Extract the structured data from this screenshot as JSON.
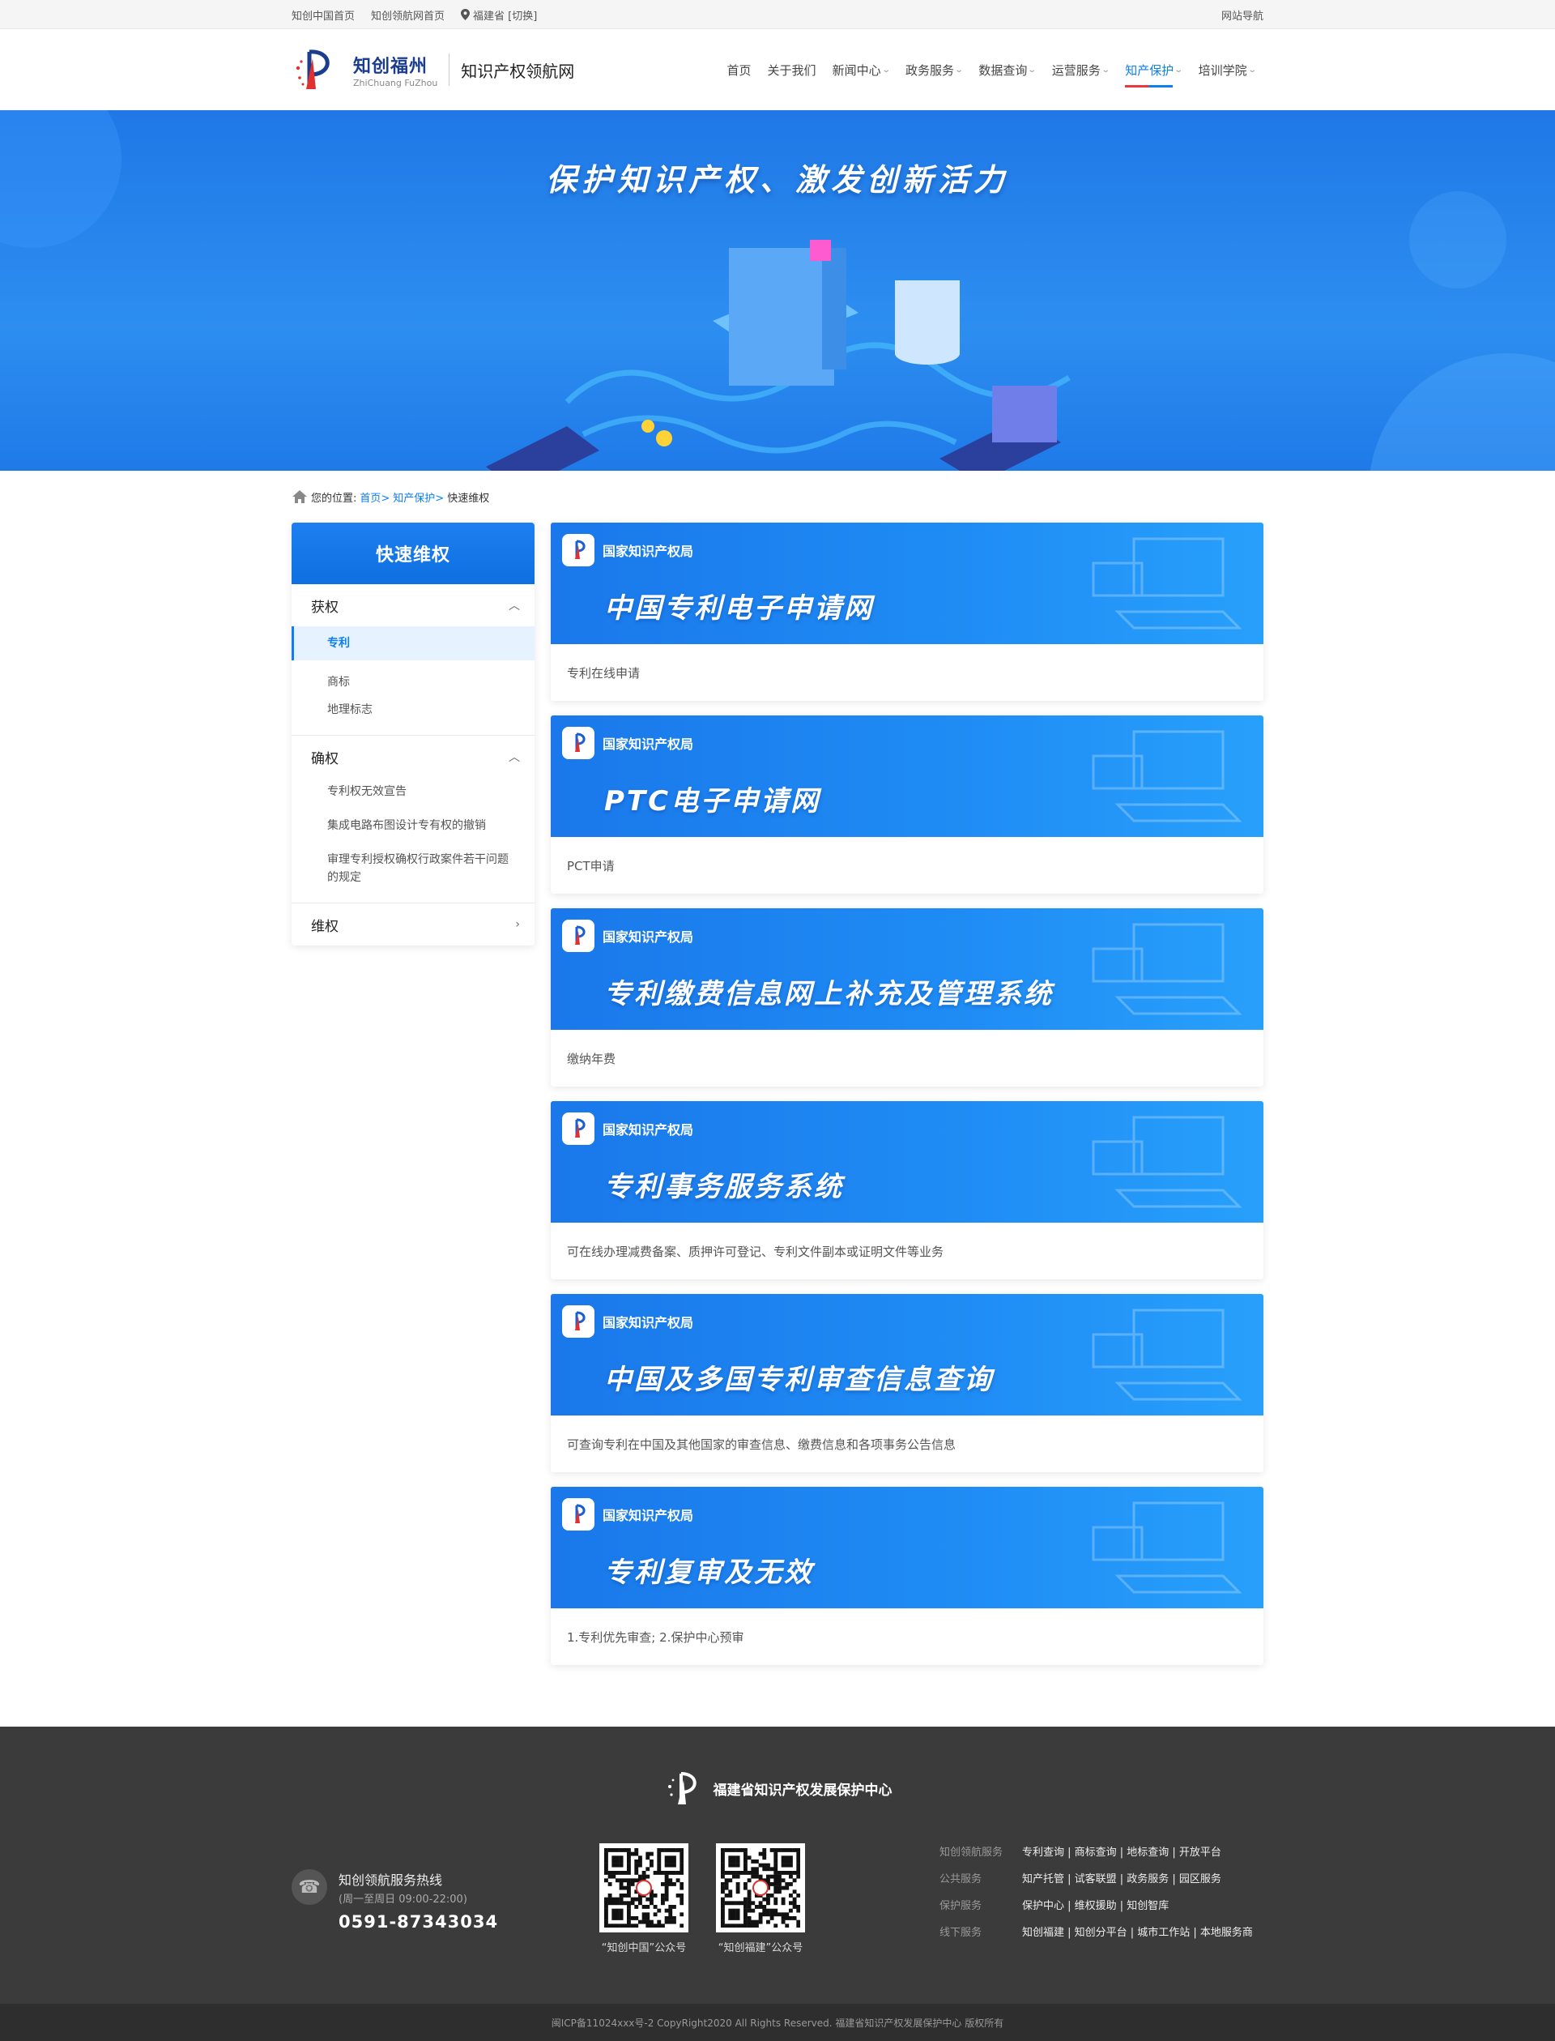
{
  "topbar": {
    "links": [
      "知创中国首页",
      "知创领航网首页"
    ],
    "location": "福建省 [切换]",
    "site_nav": "网站导航"
  },
  "header": {
    "brand_cn": "知创福州",
    "brand_en": "ZhiChuang FuZhou",
    "brand_sub": "知识产权领航网",
    "nav": [
      {
        "label": "首页",
        "dropdown": false
      },
      {
        "label": "关于我们",
        "dropdown": false
      },
      {
        "label": "新闻中心",
        "dropdown": true
      },
      {
        "label": "政务服务",
        "dropdown": true
      },
      {
        "label": "数据查询",
        "dropdown": true
      },
      {
        "label": "运营服务",
        "dropdown": true
      },
      {
        "label": "知产保护",
        "dropdown": true,
        "active": true
      },
      {
        "label": "培训学院",
        "dropdown": true
      }
    ]
  },
  "banner": {
    "title": "保护知识产权、激发创新活力"
  },
  "breadcrumb": {
    "prefix": "您的位置:",
    "home": "首页>",
    "section": "知产保护>",
    "current": "快速维权"
  },
  "sidebar": {
    "title": "快速维权",
    "groups": [
      {
        "label": "获权",
        "expanded": true,
        "items": [
          "专利",
          "商标",
          "地理标志"
        ],
        "active_item": 0
      },
      {
        "label": "确权",
        "expanded": true,
        "items": [
          "专利权无效宣告",
          "集成电路布图设计专有权的撤销",
          "审理专利授权确权行政案件若干问题的规定"
        ]
      },
      {
        "label": "维权",
        "expanded": false,
        "items": []
      }
    ]
  },
  "cards": [
    {
      "org": "国家知识产权局",
      "title": "中国专利电子申请网",
      "desc": "专利在线申请"
    },
    {
      "org": "国家知识产权局",
      "title": "PTC电子申请网",
      "desc": "PCT申请"
    },
    {
      "org": "国家知识产权局",
      "title": "专利缴费信息网上补充及管理系统",
      "desc": "缴纳年费"
    },
    {
      "org": "国家知识产权局",
      "title": "专利事务服务系统",
      "desc": "可在线办理减费备案、质押许可登记、专利文件副本或证明文件等业务"
    },
    {
      "org": "国家知识产权局",
      "title": "中国及多国专利审查信息查询",
      "desc": "可查询专利在中国及其他国家的审查信息、缴费信息和各项事务公告信息"
    },
    {
      "org": "国家知识产权局",
      "title": "专利复审及无效",
      "desc": "1.专利优先审查;    2.保护中心预审"
    }
  ],
  "footer": {
    "org": "福建省知识产权发展保护中心",
    "hotline_title": "知创领航服务热线",
    "hotline_hours": "(周一至周日 09:00-22:00)",
    "hotline_number": "0591-87343034",
    "qrcodes": [
      "“知创中国”公众号",
      "“知创福建”公众号"
    ],
    "link_rows": [
      {
        "key": "知创领航服务",
        "value": "专利查询 | 商标查询 | 地标查询 | 开放平台"
      },
      {
        "key": "公共服务",
        "value": "知产托管 | 试客联盟 | 政务服务 | 园区服务"
      },
      {
        "key": "保护服务",
        "value": "保护中心 | 维权援助 | 知创智库"
      },
      {
        "key": "线下服务",
        "value": "知创福建 | 知创分平台 | 城市工作站 | 本地服务商"
      }
    ],
    "copyright": "闽ICP备11024xxx号-2  CopyRight2020  All Rights Reserved.  福建省知识产权发展保护中心  版权所有"
  },
  "colors": {
    "accent": "#0d7ff0",
    "banner": "#1f78e6",
    "footer": "#3b3b3b"
  }
}
